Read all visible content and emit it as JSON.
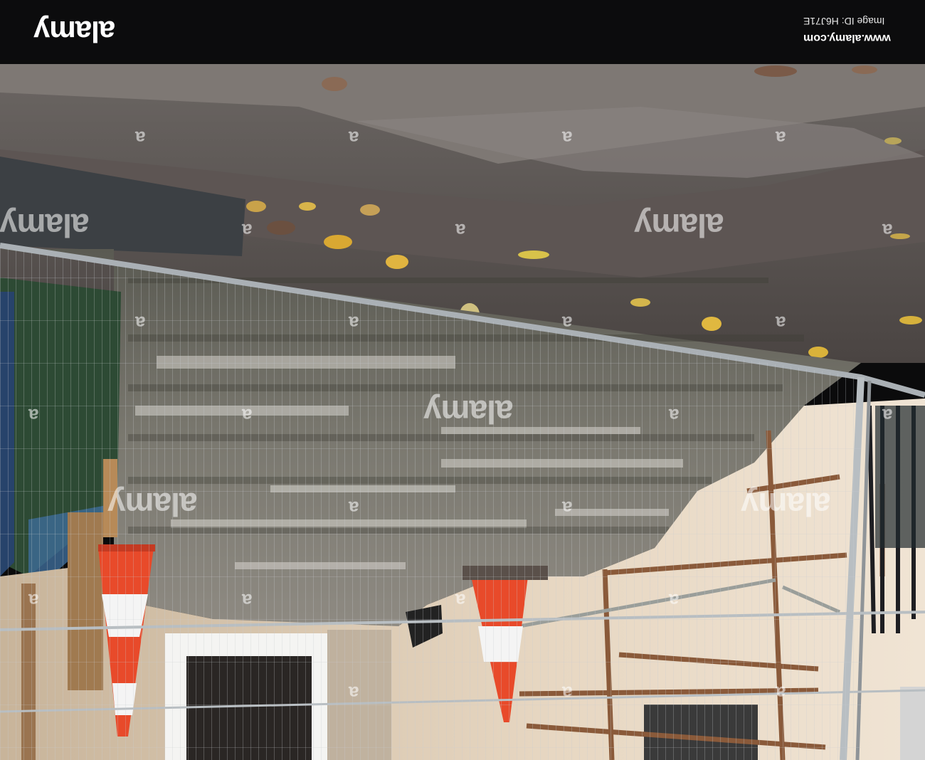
{
  "banner": {
    "logo": "alamy",
    "site_url": "www.alamy.com",
    "image_id": "Image ID: H6J71E"
  },
  "photo": {
    "subject": "upside-down view of crumbling concrete steps behind temporary mesh fencing with traffic cones and scaffolding",
    "watermark": "alamy",
    "watermark_small": "a"
  }
}
